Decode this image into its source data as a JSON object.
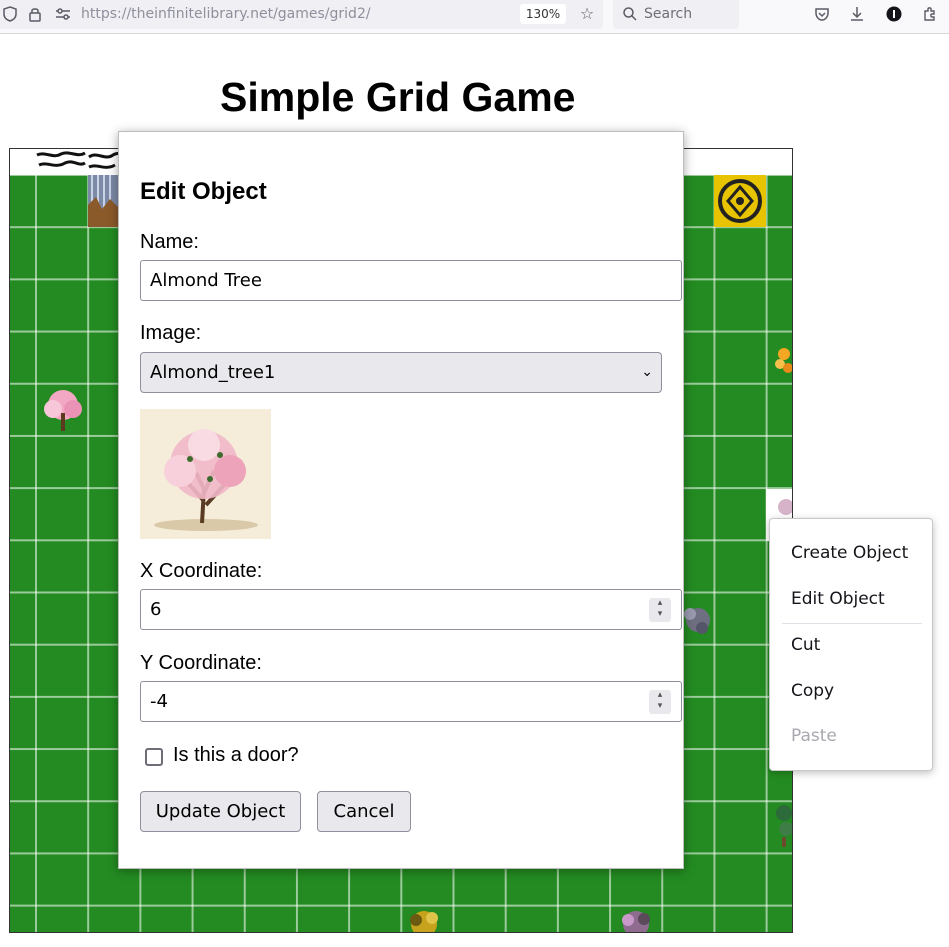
{
  "browser": {
    "url": "https://theinfinitelibrary.net/games/grid2/",
    "zoom": "130%",
    "search_placeholder": "Search"
  },
  "page": {
    "title": "Simple Grid Game"
  },
  "modal": {
    "title": "Edit Object",
    "name_label": "Name:",
    "name_value": "Almond Tree",
    "image_label": "Image:",
    "image_value": "Almond_tree1",
    "x_label": "X Coordinate:",
    "x_value": "6",
    "y_label": "Y Coordinate:",
    "y_value": "-4",
    "door_label": "Is this a door?",
    "door_checked": false,
    "update_button": "Update Object",
    "cancel_button": "Cancel"
  },
  "context_menu": {
    "items": [
      "Create Object",
      "Edit Object",
      "Cut",
      "Copy",
      "Paste"
    ],
    "disabled": [
      "Paste"
    ]
  },
  "colors": {
    "grass": "#238b21",
    "blossom": "#f2a7c3",
    "gold": "#e8c400"
  }
}
